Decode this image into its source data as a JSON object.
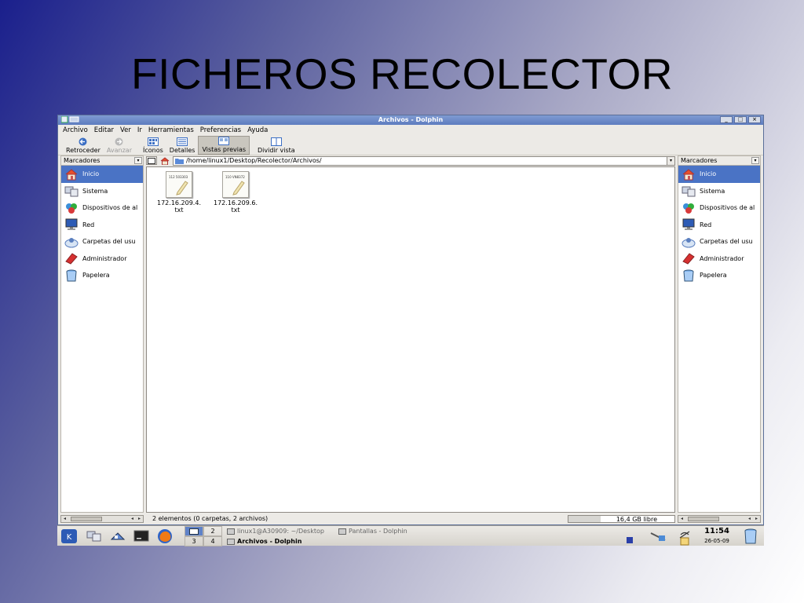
{
  "slide": {
    "title": "FICHEROS RECOLECTOR"
  },
  "window": {
    "title": "Archivos - Dolphin",
    "controls": [
      "_",
      "□",
      "×"
    ]
  },
  "menubar": [
    "Archivo",
    "Editar",
    "Ver",
    "Ir",
    "Herramientas",
    "Preferencias",
    "Ayuda"
  ],
  "toolbar": {
    "back": "Retroceder",
    "forward": "Avanzar",
    "icons": "Íconos",
    "details": "Detalles",
    "previews": "Vistas previas",
    "split": "Dividir vista"
  },
  "left_panel": {
    "header": "Marcadores",
    "items": [
      {
        "label": "Inicio",
        "icon": "home-icon",
        "selected": true
      },
      {
        "label": "Sistema",
        "icon": "system-icon"
      },
      {
        "label": "Dispositivos de al",
        "icon": "devices-icon"
      },
      {
        "label": "Red",
        "icon": "network-icon"
      },
      {
        "label": "Carpetas del usu",
        "icon": "user-folders-icon"
      },
      {
        "label": "Administrador",
        "icon": "admin-icon"
      },
      {
        "label": "Papelera",
        "icon": "trash-icon"
      }
    ]
  },
  "right_panel": {
    "header": "Marcadores",
    "items": [
      {
        "label": "Inicio",
        "icon": "home-icon",
        "selected": true
      },
      {
        "label": "Sistema",
        "icon": "system-icon"
      },
      {
        "label": "Dispositivos de al",
        "icon": "devices-icon"
      },
      {
        "label": "Red",
        "icon": "network-icon"
      },
      {
        "label": "Carpetas del usu",
        "icon": "user-folders-icon"
      },
      {
        "label": "Administrador",
        "icon": "admin-icon"
      },
      {
        "label": "Papelera",
        "icon": "trash-icon"
      }
    ]
  },
  "address": {
    "path": "/home/linux1/Desktop/Recolector/Archivos/"
  },
  "files": [
    {
      "name_line1": "172.16.209.4.",
      "name_line2": "txt",
      "preview": "112 503303"
    },
    {
      "name_line1": "172.16.209.6.",
      "name_line2": "txt",
      "preview": "110 VN8372"
    }
  ],
  "status": {
    "message": "2 elementos (0 carpetas, 2 archivos)",
    "free_space": "16,4 GB libre",
    "disk_used_fraction": 0.3
  },
  "taskbar": {
    "desktops": [
      "1",
      "2",
      "3",
      "4"
    ],
    "current_desktop": "1",
    "tasks": [
      {
        "label": "linux1@A30909: ~/Desktop",
        "active": false
      },
      {
        "label": "Pantallas - Dolphin",
        "active": false
      },
      {
        "label": "Archivos - Dolphin",
        "active": true
      }
    ],
    "clock": "11:54",
    "date": "26-05-09"
  },
  "colors": {
    "selection": "#4a73c5",
    "titlebar": "#5d7cbf"
  }
}
